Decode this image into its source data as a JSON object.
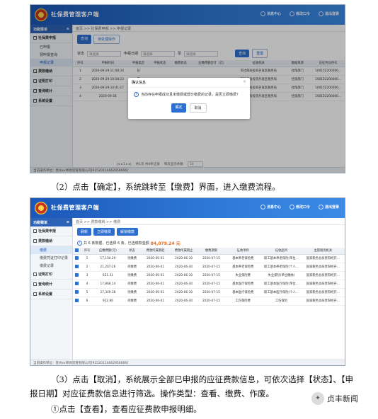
{
  "shot1": {
    "app_title": "社保费管理客户端",
    "top_links": [
      "消息中心",
      "修改口令",
      "退出登录"
    ],
    "nav_head": "功能菜单",
    "nav": [
      {
        "label": "社保费申报",
        "subs": [
          "已申报",
          "预申报查询",
          "申报记录"
        ]
      },
      {
        "label": "费款缴纳"
      },
      {
        "label": "证明打印"
      },
      {
        "label": "查询统计"
      },
      {
        "label": "系统设置"
      }
    ],
    "breadcrumb": "首页 >> 社保费申报 >> 申报记录",
    "tab_buttons": [
      "查询",
      "待处理操作"
    ],
    "filter_status_label": "状态",
    "filter_status_value": "请选择",
    "filter_date_label": "申报日期",
    "filter_date_from": "请选择",
    "filter_date_to": "请选择",
    "filter_to": "至",
    "query_btn": "查询",
    "reset_btn": "重置",
    "columns": [
      "序号",
      "申报时间",
      "申报类型",
      "申报状态",
      "缴费状态",
      "应缴费额合计（元）",
      "征收机关",
      "数据来源",
      "应征凭证序号"
    ],
    "rows": [
      [
        "1",
        "2020-09-29 11:08:34",
        "日",
        "",
        "",
        "",
        "市社保局投资开发区税务局",
        "社保部门",
        "100152200000..."
      ],
      [
        "2",
        "2020-09-29 10:58:23",
        "日",
        "",
        "",
        "",
        "市社保局投资开发区税务局",
        "社保部门",
        "100152200000..."
      ],
      [
        "3",
        "2020-09-29 10:41:17",
        "日",
        "",
        "",
        "",
        "市社保局投资开发区税务局",
        "社保部门",
        "100152200000..."
      ],
      [
        "4",
        "2020-09-28",
        "日",
        "",
        "",
        "",
        "市社保局投资开发区税务局",
        "社保部门",
        "100152200000..."
      ]
    ],
    "pager": "共1页 共4条记录",
    "page_size_label": "每页显示条数",
    "page_size": "50",
    "footer": "当前操作单位：贵州xx师财资管有限公司[91520114662956666]",
    "dialog": {
      "title": "确认信息",
      "message": "当前存在申报成功且未缴费或部分缴费的记录，是否立即缴费？",
      "ok": "确定",
      "cancel": "取消"
    }
  },
  "para1": "（2）点击【确定】，系统跳转至【缴费】界面，进入缴费流程。",
  "shot2": {
    "app_title": "社保费管理客户端",
    "top_links": [
      "消息中心",
      "修改口令",
      "退出登录"
    ],
    "nav_head": "功能菜单",
    "nav": [
      {
        "label": "社保费申报"
      },
      {
        "label": "费款缴纳",
        "subs": [
          "缴费",
          "缴费凭证打印记录",
          "缴费记录"
        ]
      },
      {
        "label": "证明打印"
      },
      {
        "label": "查询统计"
      },
      {
        "label": "系统设置"
      }
    ],
    "breadcrumb": "首页 >> 费款缴纳 >> 缴费",
    "buttons": [
      "刷新",
      "立即缴费",
      "解锁缴款"
    ],
    "summary_prefix": "共 6 条数据，已选择 6 条，已选缴款金额",
    "summary_amount": "84,079.24 元",
    "columns": [
      "",
      "序号",
      "应缴费额(元)",
      "状态",
      "费款所属期起",
      "费款所属期止",
      "缴费期限",
      "征收项目",
      "征收品目",
      "主管税务机关"
    ],
    "rows": [
      [
        "1",
        "17,150.29",
        "待缴费",
        "2020-06-01",
        "2020-06-30",
        "2020-07-15",
        "基本养老保险费",
        "职工基本养老保险(单位...",
        "国家税务总局贵阳经开..."
      ],
      [
        "2",
        "21,207.26",
        "待缴费",
        "2020-06-01",
        "2020-06-30",
        "2020-07-15",
        "基本养老保险费",
        "职工基本养老保险(个人...",
        "国家税务总局贵阳经开..."
      ],
      [
        "3",
        "621.31",
        "待缴费",
        "2020-06-01",
        "2020-06-30",
        "2020-07-15",
        "失业保险费",
        "失业保险(单位缴纳)",
        "国家税务总局贵阳经开..."
      ],
      [
        "4",
        "17,868.14",
        "待缴费",
        "2020-06-01",
        "2020-06-30",
        "2020-07-15",
        "基本医疗保险费",
        "职工基本医疗保险(单位...",
        "国家税务总局贵阳经开..."
      ],
      [
        "5",
        "27,349.38",
        "待缴费",
        "2020-06-01",
        "2020-06-30",
        "2020-07-15",
        "基本医疗保险费",
        "职工基本医疗保险(个人...",
        "国家税务总局贵阳经开..."
      ],
      [
        "6",
        "922.86",
        "待缴费",
        "2020-06-01",
        "2020-06-30",
        "2020-07-15",
        "工伤保险费",
        "工伤保险",
        "国家税务总局贵阳经开..."
      ]
    ],
    "footer": "当前操作单位：贵州xx师财资管有限公司[91520114662956666]"
  },
  "para2": "（3）点击【取消】，系统展示全部已申报的应征费款信息，可依次选择【状态】、【申报日期】对应征费款信息进行筛选。操作类型：查看、缴费、作废。",
  "para3": "①点击【查看】，查看应征费款申报明细。",
  "watermark": "贞丰新闻"
}
